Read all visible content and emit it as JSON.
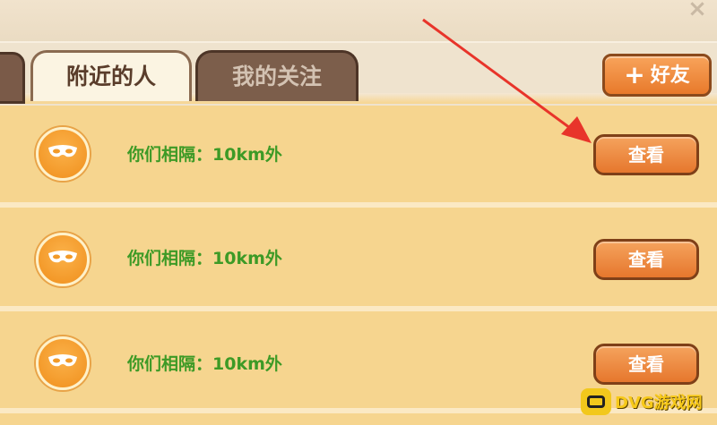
{
  "window": {
    "close_glyph": "×"
  },
  "tabs": [
    {
      "label": "附近的人",
      "active": true
    },
    {
      "label": "我的关注",
      "active": false
    }
  ],
  "add_friend": {
    "plus": "+",
    "label": "好友"
  },
  "rows": [
    {
      "distance_text": "你们相隔：10km外",
      "button_label": "查看"
    },
    {
      "distance_text": "你们相隔：10km外",
      "button_label": "查看"
    },
    {
      "distance_text": "你们相隔：10km外",
      "button_label": "查看"
    }
  ],
  "watermark": {
    "text": "DVG游戏网"
  },
  "colors": {
    "accent": "#e87a2b",
    "distance_text": "#3d9a26",
    "arrow": "#e8342a"
  },
  "icons": {
    "avatar": "mask-icon",
    "arrow": "red-arrow-annotation"
  }
}
